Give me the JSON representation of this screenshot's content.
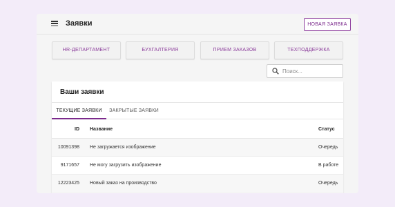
{
  "appbar": {
    "title": "Заявки",
    "new_request_label": "Новая заявка"
  },
  "departments": [
    {
      "label": "HR-департамент"
    },
    {
      "label": "Бухгалтерия"
    },
    {
      "label": "Прием заказов"
    },
    {
      "label": "Техподдержка"
    }
  ],
  "search": {
    "placeholder": "Поиск...",
    "value": ""
  },
  "card": {
    "title": "Ваши заявки",
    "tabs": [
      {
        "label": "Текущие заявки",
        "active": true
      },
      {
        "label": "Закрытые заявки",
        "active": false
      }
    ]
  },
  "table": {
    "headers": {
      "id": "ID",
      "name": "Название",
      "status": "Статус"
    },
    "rows": [
      {
        "id": "10091398",
        "name": "Не загружается изображение",
        "status": "Очередь"
      },
      {
        "id": "9171657",
        "name": "Не могу загрузить изображение",
        "status": "В работе"
      },
      {
        "id": "12223425",
        "name": "Новый заказ на производство",
        "status": "Очередь"
      }
    ]
  },
  "colors": {
    "accent": "#7b2a8c",
    "page_background": "#f3ecf9"
  },
  "icons": [
    "menu-icon",
    "search-icon"
  ]
}
